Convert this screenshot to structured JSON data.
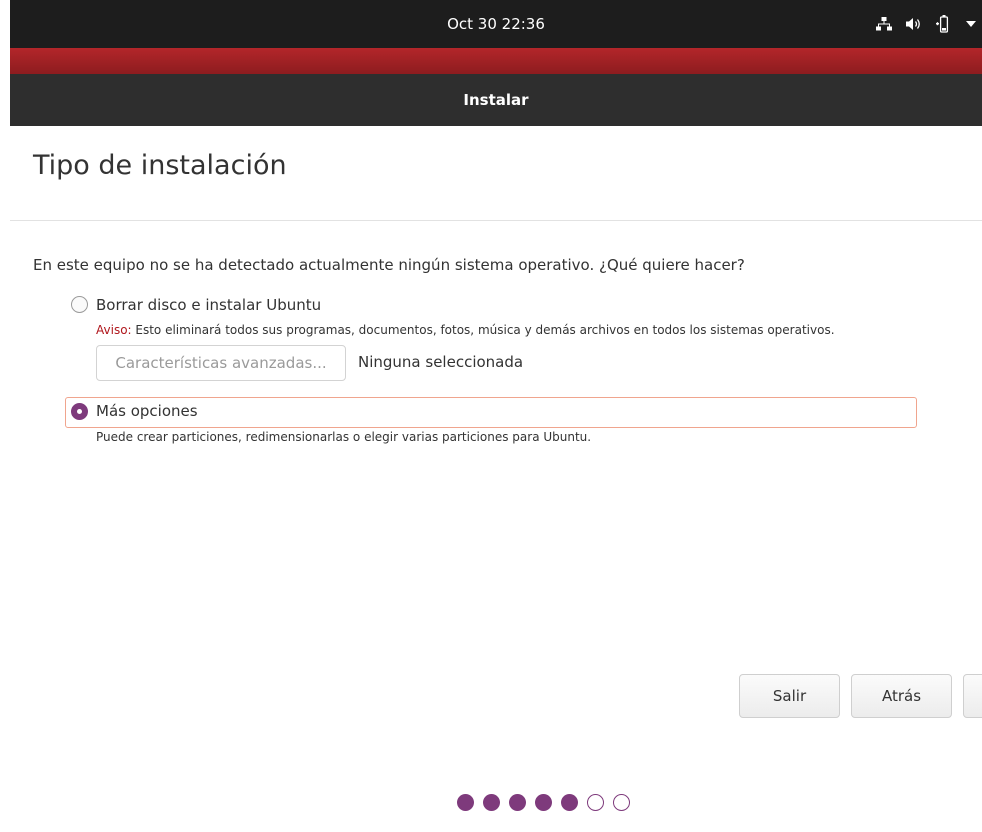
{
  "topbar": {
    "clock": "Oct 30  22:36",
    "tray_icons": [
      "network-icon",
      "volume-icon",
      "battery-icon",
      "chevron-down-icon"
    ]
  },
  "window": {
    "title": "Instalar"
  },
  "page": {
    "title": "Tipo de instalación",
    "question": "En este equipo no se ha detectado actualmente ningún sistema operativo. ¿Qué quiere hacer?"
  },
  "options": [
    {
      "label": "Borrar disco e instalar Ubuntu",
      "warning_label": "Aviso:",
      "warning_text": " Esto eliminará todos sus programas, documentos, fotos, música y demás archivos en todos los sistemas operativos.",
      "advanced_button": "Características avanzadas...",
      "advanced_status": "Ninguna seleccionada",
      "selected": false
    },
    {
      "label": "Más opciones",
      "description": "Puede crear particiones, redimensionarlas o elegir varias particiones para Ubuntu.",
      "selected": true
    }
  ],
  "buttons": {
    "quit": "Salir",
    "back": "Atrás"
  },
  "progress": {
    "total_steps": 7,
    "completed_steps": 5
  },
  "colors": {
    "accent": "#7e3a7c",
    "warning": "#b0161c",
    "header_red": "#a01f22"
  }
}
